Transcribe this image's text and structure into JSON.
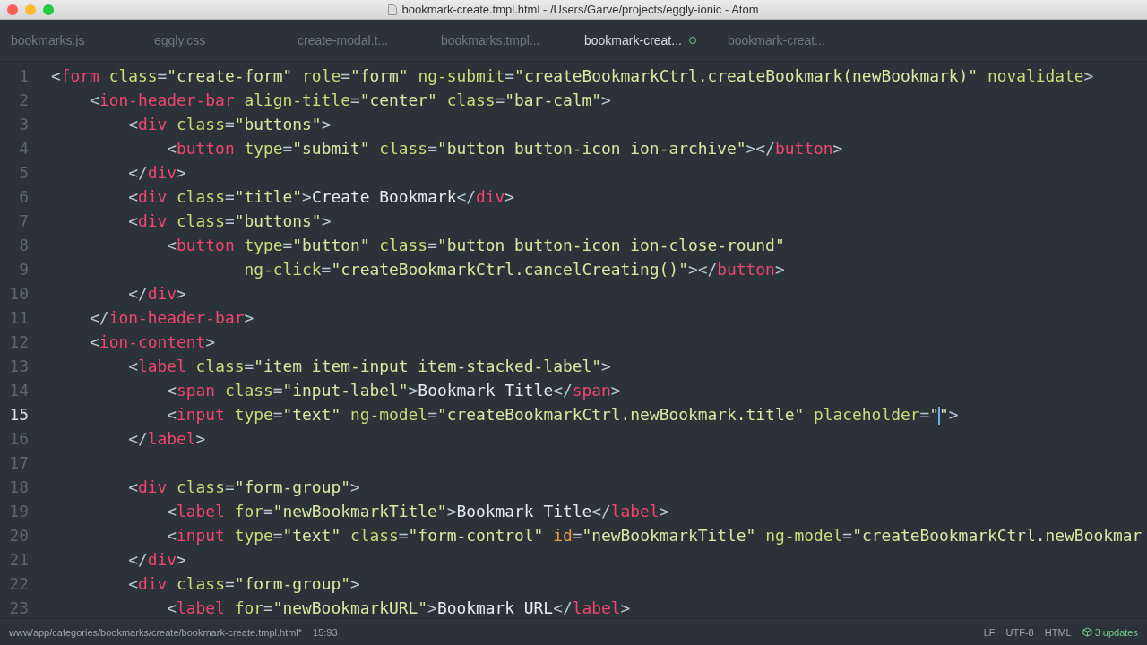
{
  "window": {
    "title": "bookmark-create.tmpl.html - /Users/Garve/projects/eggly-ionic - Atom"
  },
  "tabs": [
    {
      "label": "bookmarks.js",
      "selected": false,
      "modified": false
    },
    {
      "label": "eggly.css",
      "selected": false,
      "modified": false
    },
    {
      "label": "create-modal.t...",
      "selected": false,
      "modified": false
    },
    {
      "label": "bookmarks.tmpl...",
      "selected": false,
      "modified": false
    },
    {
      "label": "bookmark-creat...",
      "selected": true,
      "modified": true
    },
    {
      "label": "bookmark-creat...",
      "selected": false,
      "modified": false
    }
  ],
  "editor": {
    "lines": [
      {
        "number": "1",
        "current": false,
        "tokens": [
          {
            "kind": "p",
            "text": "<"
          },
          {
            "kind": "t",
            "text": "form"
          },
          {
            "kind": "a",
            "text": " class"
          },
          {
            "kind": "p",
            "text": "="
          },
          {
            "kind": "s",
            "text": "\"create-form\""
          },
          {
            "kind": "a",
            "text": " role"
          },
          {
            "kind": "p",
            "text": "="
          },
          {
            "kind": "s",
            "text": "\"form\""
          },
          {
            "kind": "a",
            "text": " ng-submit"
          },
          {
            "kind": "p",
            "text": "="
          },
          {
            "kind": "s",
            "text": "\"createBookmarkCtrl.createBookmark(newBookmark)\""
          },
          {
            "kind": "a",
            "text": " novalidate"
          },
          {
            "kind": "p",
            "text": ">"
          }
        ]
      },
      {
        "number": "2",
        "current": false,
        "tokens": [
          {
            "kind": "p",
            "text": "    <"
          },
          {
            "kind": "t",
            "text": "ion-header-bar"
          },
          {
            "kind": "a",
            "text": " align-title"
          },
          {
            "kind": "p",
            "text": "="
          },
          {
            "kind": "s",
            "text": "\"center\""
          },
          {
            "kind": "a",
            "text": " class"
          },
          {
            "kind": "p",
            "text": "="
          },
          {
            "kind": "s",
            "text": "\"bar-calm\""
          },
          {
            "kind": "p",
            "text": ">"
          }
        ]
      },
      {
        "number": "3",
        "current": false,
        "tokens": [
          {
            "kind": "p",
            "text": "        <"
          },
          {
            "kind": "t",
            "text": "div"
          },
          {
            "kind": "a",
            "text": " class"
          },
          {
            "kind": "p",
            "text": "="
          },
          {
            "kind": "s",
            "text": "\"buttons\""
          },
          {
            "kind": "p",
            "text": ">"
          }
        ]
      },
      {
        "number": "4",
        "current": false,
        "tokens": [
          {
            "kind": "p",
            "text": "            <"
          },
          {
            "kind": "t",
            "text": "button"
          },
          {
            "kind": "a",
            "text": " type"
          },
          {
            "kind": "p",
            "text": "="
          },
          {
            "kind": "s",
            "text": "\"submit\""
          },
          {
            "kind": "a",
            "text": " class"
          },
          {
            "kind": "p",
            "text": "="
          },
          {
            "kind": "s",
            "text": "\"button button-icon ion-archive\""
          },
          {
            "kind": "p",
            "text": "></"
          },
          {
            "kind": "t",
            "text": "button"
          },
          {
            "kind": "p",
            "text": ">"
          }
        ]
      },
      {
        "number": "5",
        "current": false,
        "tokens": [
          {
            "kind": "p",
            "text": "        </"
          },
          {
            "kind": "t",
            "text": "div"
          },
          {
            "kind": "p",
            "text": ">"
          }
        ]
      },
      {
        "number": "6",
        "current": false,
        "tokens": [
          {
            "kind": "p",
            "text": "        <"
          },
          {
            "kind": "t",
            "text": "div"
          },
          {
            "kind": "a",
            "text": " class"
          },
          {
            "kind": "p",
            "text": "="
          },
          {
            "kind": "s",
            "text": "\"title\""
          },
          {
            "kind": "p",
            "text": ">"
          },
          {
            "kind": "x",
            "text": "Create Bookmark"
          },
          {
            "kind": "p",
            "text": "</"
          },
          {
            "kind": "t",
            "text": "div"
          },
          {
            "kind": "p",
            "text": ">"
          }
        ]
      },
      {
        "number": "7",
        "current": false,
        "tokens": [
          {
            "kind": "p",
            "text": "        <"
          },
          {
            "kind": "t",
            "text": "div"
          },
          {
            "kind": "a",
            "text": " class"
          },
          {
            "kind": "p",
            "text": "="
          },
          {
            "kind": "s",
            "text": "\"buttons\""
          },
          {
            "kind": "p",
            "text": ">"
          }
        ]
      },
      {
        "number": "8",
        "current": false,
        "tokens": [
          {
            "kind": "p",
            "text": "            <"
          },
          {
            "kind": "t",
            "text": "button"
          },
          {
            "kind": "a",
            "text": " type"
          },
          {
            "kind": "p",
            "text": "="
          },
          {
            "kind": "s",
            "text": "\"button\""
          },
          {
            "kind": "a",
            "text": " class"
          },
          {
            "kind": "p",
            "text": "="
          },
          {
            "kind": "s",
            "text": "\"button button-icon ion-close-round\""
          }
        ]
      },
      {
        "number": "9",
        "current": false,
        "tokens": [
          {
            "kind": "a",
            "text": "                    ng-click"
          },
          {
            "kind": "p",
            "text": "="
          },
          {
            "kind": "s",
            "text": "\"createBookmarkCtrl.cancelCreating()\""
          },
          {
            "kind": "p",
            "text": "></"
          },
          {
            "kind": "t",
            "text": "button"
          },
          {
            "kind": "p",
            "text": ">"
          }
        ]
      },
      {
        "number": "10",
        "current": false,
        "tokens": [
          {
            "kind": "p",
            "text": "        </"
          },
          {
            "kind": "t",
            "text": "div"
          },
          {
            "kind": "p",
            "text": ">"
          }
        ]
      },
      {
        "number": "11",
        "current": false,
        "tokens": [
          {
            "kind": "p",
            "text": "    </"
          },
          {
            "kind": "t",
            "text": "ion-header-bar"
          },
          {
            "kind": "p",
            "text": ">"
          }
        ]
      },
      {
        "number": "12",
        "current": false,
        "tokens": [
          {
            "kind": "p",
            "text": "    <"
          },
          {
            "kind": "t",
            "text": "ion-content"
          },
          {
            "kind": "p",
            "text": ">"
          }
        ]
      },
      {
        "number": "13",
        "current": false,
        "tokens": [
          {
            "kind": "p",
            "text": "        <"
          },
          {
            "kind": "t",
            "text": "label"
          },
          {
            "kind": "a",
            "text": " class"
          },
          {
            "kind": "p",
            "text": "="
          },
          {
            "kind": "s",
            "text": "\"item item-input item-stacked-label\""
          },
          {
            "kind": "p",
            "text": ">"
          }
        ]
      },
      {
        "number": "14",
        "current": false,
        "tokens": [
          {
            "kind": "p",
            "text": "            <"
          },
          {
            "kind": "t",
            "text": "span"
          },
          {
            "kind": "a",
            "text": " class"
          },
          {
            "kind": "p",
            "text": "="
          },
          {
            "kind": "s",
            "text": "\"input-label\""
          },
          {
            "kind": "p",
            "text": ">"
          },
          {
            "kind": "x",
            "text": "Bookmark Title"
          },
          {
            "kind": "p",
            "text": "</"
          },
          {
            "kind": "t",
            "text": "span"
          },
          {
            "kind": "p",
            "text": ">"
          }
        ]
      },
      {
        "number": "15",
        "current": true,
        "tokens": [
          {
            "kind": "p",
            "text": "            <"
          },
          {
            "kind": "t",
            "text": "input"
          },
          {
            "kind": "a",
            "text": " type"
          },
          {
            "kind": "p",
            "text": "="
          },
          {
            "kind": "s",
            "text": "\"text\""
          },
          {
            "kind": "a",
            "text": " ng-model"
          },
          {
            "kind": "p",
            "text": "="
          },
          {
            "kind": "s",
            "text": "\"createBookmarkCtrl.newBookmark.title\""
          },
          {
            "kind": "a",
            "text": " placeholder"
          },
          {
            "kind": "p",
            "text": "="
          },
          {
            "kind": "s",
            "text": "\""
          },
          {
            "kind": "cursor"
          },
          {
            "kind": "s",
            "text": "\""
          },
          {
            "kind": "p",
            "text": ">"
          }
        ]
      },
      {
        "number": "16",
        "current": false,
        "tokens": [
          {
            "kind": "p",
            "text": "        </"
          },
          {
            "kind": "t",
            "text": "label"
          },
          {
            "kind": "p",
            "text": ">"
          }
        ]
      },
      {
        "number": "17",
        "current": false
      },
      {
        "number": "18",
        "current": false,
        "tokens": [
          {
            "kind": "p",
            "text": "        <"
          },
          {
            "kind": "t",
            "text": "div"
          },
          {
            "kind": "a",
            "text": " class"
          },
          {
            "kind": "p",
            "text": "="
          },
          {
            "kind": "s",
            "text": "\"form-group\""
          },
          {
            "kind": "p",
            "text": ">"
          }
        ]
      },
      {
        "number": "19",
        "current": false,
        "tokens": [
          {
            "kind": "p",
            "text": "            <"
          },
          {
            "kind": "t",
            "text": "label"
          },
          {
            "kind": "a",
            "text": " for"
          },
          {
            "kind": "p",
            "text": "="
          },
          {
            "kind": "s",
            "text": "\"newBookmarkTitle\""
          },
          {
            "kind": "p",
            "text": ">"
          },
          {
            "kind": "x",
            "text": "Bookmark Title"
          },
          {
            "kind": "p",
            "text": "</"
          },
          {
            "kind": "t",
            "text": "label"
          },
          {
            "kind": "p",
            "text": ">"
          }
        ]
      },
      {
        "number": "20",
        "current": false,
        "tokens": [
          {
            "kind": "p",
            "text": "            <"
          },
          {
            "kind": "t",
            "text": "input"
          },
          {
            "kind": "a",
            "text": " type"
          },
          {
            "kind": "p",
            "text": "="
          },
          {
            "kind": "s",
            "text": "\"text\""
          },
          {
            "kind": "a",
            "text": " class"
          },
          {
            "kind": "p",
            "text": "="
          },
          {
            "kind": "s",
            "text": "\"form-control\""
          },
          {
            "kind": "i",
            "text": " id"
          },
          {
            "kind": "p",
            "text": "="
          },
          {
            "kind": "s",
            "text": "\"newBookmarkTitle\""
          },
          {
            "kind": "a",
            "text": " ng-model"
          },
          {
            "kind": "p",
            "text": "="
          },
          {
            "kind": "s",
            "text": "\"createBookmarkCtrl.newBookmar"
          }
        ]
      },
      {
        "number": "21",
        "current": false,
        "tokens": [
          {
            "kind": "p",
            "text": "        </"
          },
          {
            "kind": "t",
            "text": "div"
          },
          {
            "kind": "p",
            "text": ">"
          }
        ]
      },
      {
        "number": "22",
        "current": false,
        "tokens": [
          {
            "kind": "p",
            "text": "        <"
          },
          {
            "kind": "t",
            "text": "div"
          },
          {
            "kind": "a",
            "text": " class"
          },
          {
            "kind": "p",
            "text": "="
          },
          {
            "kind": "s",
            "text": "\"form-group\""
          },
          {
            "kind": "p",
            "text": ">"
          }
        ]
      },
      {
        "number": "23",
        "current": false,
        "tokens": [
          {
            "kind": "p",
            "text": "            <"
          },
          {
            "kind": "t",
            "text": "label"
          },
          {
            "kind": "a",
            "text": " for"
          },
          {
            "kind": "p",
            "text": "="
          },
          {
            "kind": "s",
            "text": "\"newBookmarkURL\""
          },
          {
            "kind": "p",
            "text": ">"
          },
          {
            "kind": "x",
            "text": "Bookmark URL"
          },
          {
            "kind": "p",
            "text": "</"
          },
          {
            "kind": "t",
            "text": "label"
          },
          {
            "kind": "p",
            "text": ">"
          }
        ]
      }
    ]
  },
  "status_bar": {
    "path": "www/app/categories/bookmarks/create/bookmark-create.tmpl.html*",
    "position": "15:93",
    "line_ending": "LF",
    "encoding": "UTF-8",
    "grammar": "HTML",
    "updates": "3 updates"
  }
}
